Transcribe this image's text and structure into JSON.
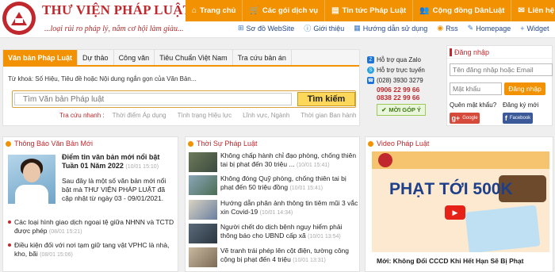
{
  "header": {
    "brand": "THƯ VIỆN PHÁP LUẬT",
    "slogan": "...loại rủi ro pháp lý, nắm cơ hội làm giàu...",
    "nav": [
      {
        "label": "Trang chủ",
        "icon": "home-icon"
      },
      {
        "label": "Các gói dịch vụ",
        "icon": "cart-icon"
      },
      {
        "label": "Tin tức Pháp Luật",
        "icon": "news-icon"
      },
      {
        "label": "Cộng đồng DânLuật",
        "icon": "community-icon"
      },
      {
        "label": "Liên hệ",
        "icon": "contact-icon"
      }
    ],
    "subnav": [
      {
        "label": "Sơ đồ WebSite",
        "icon": "sitemap-icon"
      },
      {
        "label": "Giới thiệu",
        "icon": "info-icon"
      },
      {
        "label": "Hướng dẫn sử dụng",
        "icon": "guide-icon"
      },
      {
        "label": "Rss",
        "icon": "rss-icon"
      },
      {
        "label": "Homepage",
        "icon": "home-icon"
      },
      {
        "label": "Widget",
        "icon": "widget-icon"
      }
    ]
  },
  "search": {
    "tabs": [
      "Văn bản Pháp Luật",
      "Dự thảo",
      "Công văn",
      "Tiêu Chuẩn Việt Nam",
      "Tra cứu bản án"
    ],
    "hint_label": "Từ khoá:",
    "hint_text": "Số Hiệu, Tiêu đề hoặc Nội dung ngắn gọn của Văn Bản...",
    "placeholder": "Tìm Văn bản Pháp luật",
    "button": "Tìm kiếm",
    "quick_label": "Tra cứu nhanh :",
    "quick_links": [
      "Thời điểm Áp dụng",
      "Tình trạng Hiệu lực",
      "Lĩnh vực, Ngành",
      "Thời gian Ban hành"
    ]
  },
  "support": {
    "zalo": "Hỗ trợ qua Zalo",
    "online": "Hỗ trợ trực tuyến",
    "phones": [
      "(028) 3930 3279",
      "0906 22 99 66",
      "0838 22 99 66"
    ],
    "feedback": "MỜI GÓP Ý"
  },
  "login": {
    "title": "Đăng nhập",
    "user_placeholder": "Tên đăng nhập hoặc Email",
    "pass_placeholder": "Mật khẩu",
    "button": "Đăng nhập",
    "forgot": "Quên mật khẩu?",
    "register": "Đăng ký mới",
    "google": "Google",
    "facebook": "Facebook"
  },
  "col1": {
    "title": "Thông Báo Văn Bản Mới",
    "feature_title": "Điểm tin văn bản mới nổi bật Tuần 01 Năm 2022",
    "feature_time": "(10/01 15:10)",
    "feature_desc": "Sau đây là một số văn bản mới nổi bật mà THƯ VIỆN PHÁP LUẬT đã cập nhật từ ngày 03 - 09/01/2021.",
    "items": [
      {
        "text": "Các loại hình giao dịch ngoại tệ giữa NHNN và TCTD được phép",
        "time": "(08/01 15:21)"
      },
      {
        "text": "Điều kiện đối với nơi tạm giữ tang vật VPHC là nhà, kho, bãi",
        "time": "(08/01 15:06)"
      }
    ]
  },
  "col2": {
    "title": "Thời Sự Pháp Luật",
    "items": [
      {
        "text": "Không chấp hành chỉ đạo phòng, chống thiên tai bị phạt đến 30 triệu ...",
        "time": "(10/01 15:41)"
      },
      {
        "text": "Không đóng Quỹ phòng, chống thiên tai bị phạt đến 50 triệu đồng",
        "time": "(10/01 15:41)"
      },
      {
        "text": "Hướng dẫn phân ảnh thông tin tiêm mũi 3 vắc xin Covid-19",
        "time": "(10/01 14:34)"
      },
      {
        "text": "Người chết do dịch bệnh nguy hiểm phải thông báo cho UBND cấp xã",
        "time": "(10/01 13:54)"
      },
      {
        "text": "Vẽ tranh trái phép lên cột điện, tường công cộng bị phạt đến 4 triệu",
        "time": "(10/01 13:31)"
      }
    ]
  },
  "col3": {
    "title": "Video Pháp Luật",
    "video_text": "PHẠT TỚI 500K",
    "caption": "Mới: Không Đổi CCCD Khi Hết Hạn Sẽ Bị Phạt"
  },
  "colors": {
    "accent": "#f29101",
    "brand": "#c0282d"
  }
}
